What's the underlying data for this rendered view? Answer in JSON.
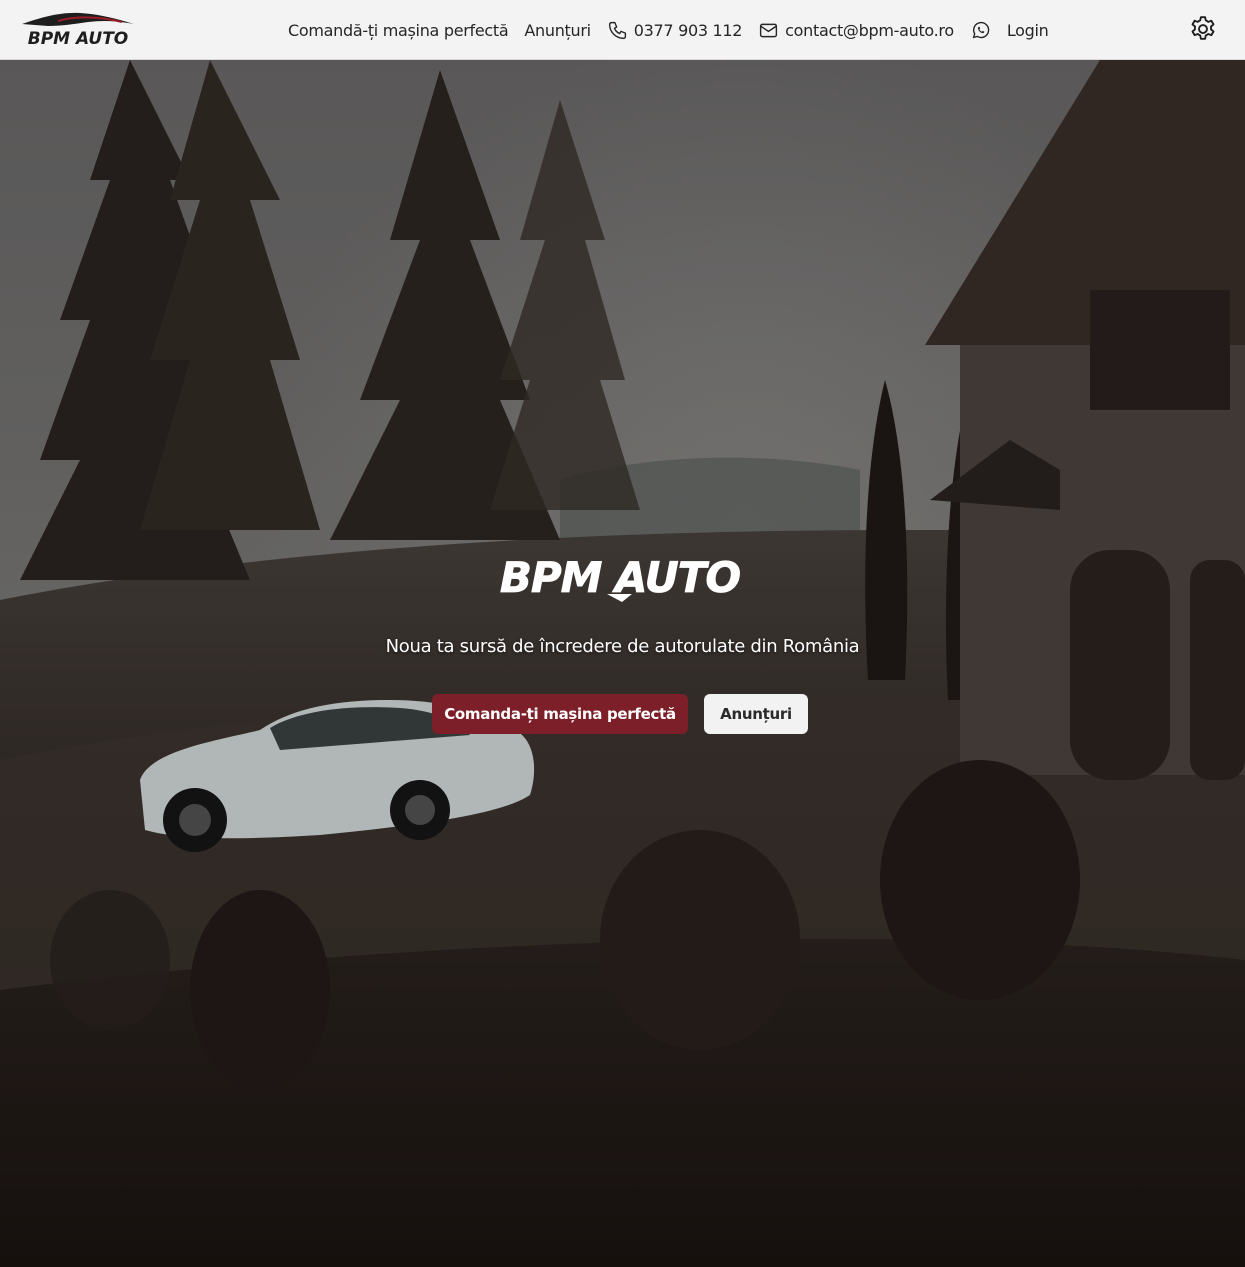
{
  "header": {
    "logo_text": "BPM AUTO",
    "nav": {
      "order_car": "Comandă-ți mașina perfectă",
      "listings": "Anunțuri",
      "phone": "0377 903 112",
      "email": "contact@bpm-auto.ro",
      "login": "Login"
    },
    "icons": {
      "phone": "phone-icon",
      "email": "mail-icon",
      "whatsapp": "whatsapp-icon",
      "settings": "gear-icon"
    }
  },
  "hero": {
    "brand": "BPM AUTO",
    "tagline": "Noua ta sursă de încredere de autorulate din România",
    "primary_button": "Comanda-ți mașina perfectă",
    "secondary_button": "Anunțuri"
  },
  "colors": {
    "header_bg": "#f3f3f3",
    "accent": "#7c1f28",
    "secondary_button_bg": "#f2f2f2"
  }
}
